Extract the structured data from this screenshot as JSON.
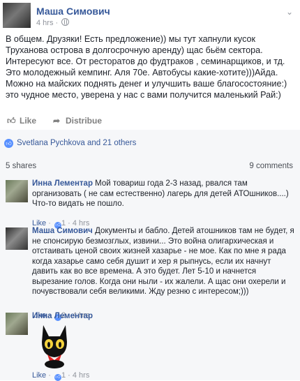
{
  "post": {
    "author": "Маша Симович",
    "time": "4 hrs ·",
    "text": "В общем. Друзяки! Есть предложение)) мы тут хапнули кусок Труханова острова в долгосрочную аренду) щас бьём сектора. Интересуют все. От ресторатов до фудтраков , семинарщиков, и тд. Это молодежный кемпинг. Аля 70е. Автобусы какие-хотите)))Айда. Можно на майских поднять денег и улучшить ваше благосостояние:) это чудное место, уверена у нас с вами получится маленький Рай:)"
  },
  "actions": {
    "like": "Like",
    "distribute": "Distribue"
  },
  "likes_text": "Svetlana Pychkova and 21 others",
  "shares": "5 shares",
  "comments_count": "9 comments",
  "comments": [
    {
      "name": "Инна Лементар",
      "text": "Мой товариш года 2-3 назад, рвался там организовать ( не сам естественно) лагерь для детей АТОшников....)",
      "text2": "Что-то видать не пошло.",
      "meta_like": "Like",
      "meta_rest": " · 1 · 4 hrs",
      "likes": "1"
    },
    {
      "name": "Маша Симович",
      "text": "Документы и бабло. Детей атошников там не будет, я не спонсирую безмозглых, извини... Это война олигархическая и отстаивать ценой своих жизней хазарье - не мое. Как по мне я рада когда хазарье само себя душит и хер я рыпнусь, если их начнут давить как во все времена. А это будет. Лет 5-10 и начнется вырезание голов. Когда они ныли - их жалели. А щас они охерели и почувствовали себя великими. Жду резню с интересом;)))",
      "meta_like": "Like",
      "likes": "2",
      "meta_rest": "· 4 hrs"
    },
    {
      "name": "Инна Лементар",
      "meta_like": "Like",
      "likes": "1",
      "meta_rest": "· 4 hrs"
    }
  ],
  "icons": {
    "like": "thumbs-up-icon",
    "share": "share-arrow-icon",
    "privacy": "globe-icon",
    "menu": "chevron-down-icon"
  },
  "colors": {
    "link": "#365899",
    "like_badge": "#5890ff",
    "meta": "#90949c"
  }
}
